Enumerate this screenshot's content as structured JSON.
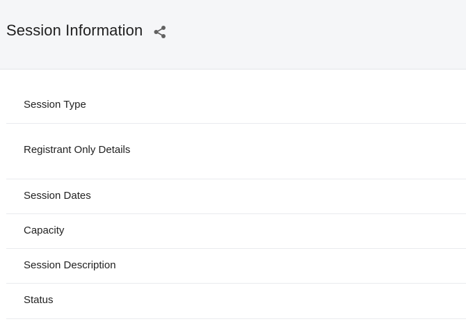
{
  "header": {
    "title": "Session Information",
    "share_icon": "share-icon"
  },
  "fields": [
    {
      "label": "Session Type"
    },
    {
      "label": "Registrant Only Details"
    },
    {
      "label": "Session Dates"
    },
    {
      "label": "Capacity"
    },
    {
      "label": "Session Description"
    },
    {
      "label": "Status"
    }
  ],
  "colors": {
    "header_bg": "#f5f6f8",
    "divider": "#e9ebee",
    "text": "#212121",
    "icon": "#616161"
  }
}
